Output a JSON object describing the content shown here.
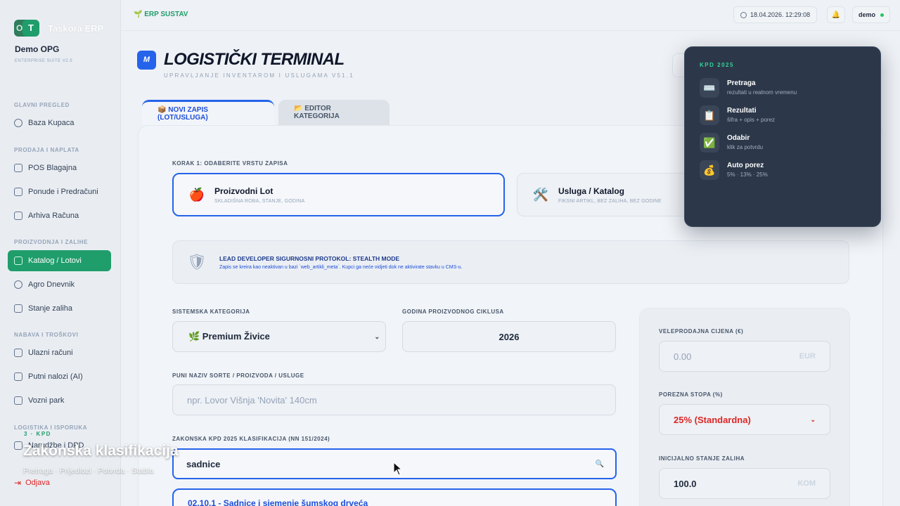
{
  "sidebar": {
    "brand_initial_back": "O",
    "brand_initial_front": "T",
    "brand_name": "Taskora ERP",
    "org_name": "Demo OPG",
    "org_sub": "ENTERPRISE SUITE V2.5",
    "sections": {
      "glavni": "GLAVNI PREGLED",
      "prodaja": "PRODAJA I NAPLATA",
      "proizvodnja": "PROIZVODNJA I ZALIHE",
      "nabava": "NABAVA I TROŠKOVI",
      "logistika": "LOGISTIKA I ISPORUKA"
    },
    "items": {
      "baza_kupaca": "Baza Kupaca",
      "pos": "POS Blagajna",
      "ponude": "Ponude i Predračuni",
      "arhiva": "Arhiva Računa",
      "katalog": "Katalog / Lotovi",
      "agro": "Agro Dnevnik",
      "stanje": "Stanje zaliha",
      "ulazni": "Ulazni računi",
      "putni": "Putni nalozi (AI)",
      "vozni": "Vozni park",
      "narudzbe": "Narudžbe i DPD"
    },
    "logout": "Odjava"
  },
  "topbar": {
    "erp_tag": "🌱 ERP SUSTAV",
    "datetime": "18.04.2026. 12:29:08",
    "user": "demo"
  },
  "header": {
    "logo": "M",
    "title": "LOGISTIČKI TERMINAL",
    "subtitle": "UPRAVLJANJE INVENTAROM I USLUGAMA V51.1"
  },
  "tabs": {
    "new_record": "📦 NOVI ZAPIS (LOT/USLUGA)",
    "category_editor": "📂 EDITOR KATEGORIJA"
  },
  "form": {
    "step_label": "KORAK 1: ODABERITE VRSTU ZAPISA",
    "type_lot": {
      "icon": "🍎",
      "title": "Proizvodni Lot",
      "sub": "SKLADIŠNA ROBA, STANJE, GODINA"
    },
    "type_service": {
      "icon": "🛠️",
      "title": "Usluga / Katalog",
      "sub": "FIKSNI ARTIKL, BEZ ZALIHA, BEZ GODINE"
    },
    "notice_title": "LEAD DEVELOPER SIGURNOSNI PROTOKOL: STEALTH MODE",
    "notice_sub": "Zapis se kreira kao neaktivan u bazi `web_artikli_meta`. Kupci ga neće vidjeti dok ne aktivirate stavku u CMS-u.",
    "category_label": "SISTEMSKA KATEGORIJA",
    "category_value": "🌿 Premium Živice",
    "year_label": "GODINA PROIZVODNOG CIKLUSA",
    "year_value": "2026",
    "name_label": "PUNI NAZIV SORTE / PROIZVODA / USLUGE",
    "name_placeholder": "npr. Lovor Višnja 'Novita' 140cm",
    "kpd_label": "ZAKONSKA KPD 2025 KLASIFIKACIJA (NN 151/2024)",
    "kpd_value": "sadnice",
    "kpd_result": "02.10.1 - Sadnice i sjemenje šumskog drveća"
  },
  "pricing": {
    "wholesale_label": "VELEPRODAJNA CIJENA (€)",
    "wholesale_placeholder": "0.00",
    "wholesale_unit": "EUR",
    "tax_label": "POREZNA STOPA (%)",
    "tax_value": "25% (Standardna)",
    "stock_label": "INICIJALNO STANJE ZALIHA",
    "stock_value": "100.0",
    "stock_unit": "KOM"
  },
  "popover": {
    "heading": "KPD 2025",
    "items": [
      {
        "icon": "⌨️",
        "title": "Pretraga",
        "sub": "rezultati u realnom vremenu"
      },
      {
        "icon": "📋",
        "title": "Rezultati",
        "sub": "šifra + opis + porez"
      },
      {
        "icon": "✅",
        "title": "Odabir",
        "sub": "klik za potvrdu"
      },
      {
        "icon": "💰",
        "title": "Auto porez",
        "sub": "5% · 13% · 25%"
      }
    ]
  },
  "caption": {
    "tag": "3 · KPD",
    "title": "Zakonska klasifikacija",
    "sub": "Pretraga · Prijedlozi · Potvrda · Stabla"
  },
  "colors": {
    "accent_green": "#1f9d6b",
    "accent_blue": "#2563eb",
    "danger": "#dc2626",
    "popover_bg": "#2c3849"
  }
}
